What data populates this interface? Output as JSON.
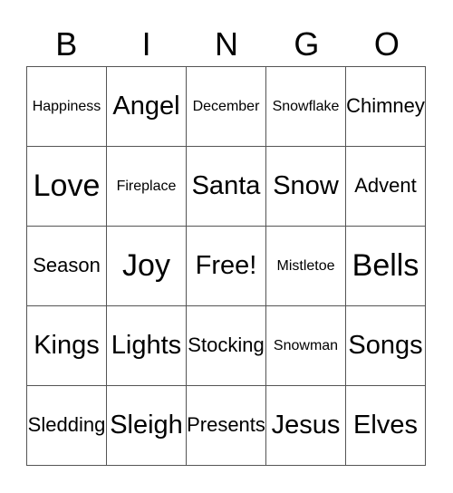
{
  "header": [
    "B",
    "I",
    "N",
    "G",
    "O"
  ],
  "rows": [
    [
      {
        "text": "Happiness",
        "size": "sm"
      },
      {
        "text": "Angel",
        "size": "lg"
      },
      {
        "text": "December",
        "size": "sm"
      },
      {
        "text": "Snowflake",
        "size": "sm"
      },
      {
        "text": "Chimney",
        "size": "md"
      }
    ],
    [
      {
        "text": "Love",
        "size": "xl"
      },
      {
        "text": "Fireplace",
        "size": "sm"
      },
      {
        "text": "Santa",
        "size": "lg"
      },
      {
        "text": "Snow",
        "size": "lg"
      },
      {
        "text": "Advent",
        "size": "md"
      }
    ],
    [
      {
        "text": "Season",
        "size": "md"
      },
      {
        "text": "Joy",
        "size": "xl"
      },
      {
        "text": "Free!",
        "size": "lg"
      },
      {
        "text": "Mistletoe",
        "size": "sm"
      },
      {
        "text": "Bells",
        "size": "xl"
      }
    ],
    [
      {
        "text": "Kings",
        "size": "lg"
      },
      {
        "text": "Lights",
        "size": "lg"
      },
      {
        "text": "Stocking",
        "size": "md"
      },
      {
        "text": "Snowman",
        "size": "sm"
      },
      {
        "text": "Songs",
        "size": "lg"
      }
    ],
    [
      {
        "text": "Sledding",
        "size": "md"
      },
      {
        "text": "Sleigh",
        "size": "lg"
      },
      {
        "text": "Presents",
        "size": "md"
      },
      {
        "text": "Jesus",
        "size": "lg"
      },
      {
        "text": "Elves",
        "size": "lg"
      }
    ]
  ]
}
